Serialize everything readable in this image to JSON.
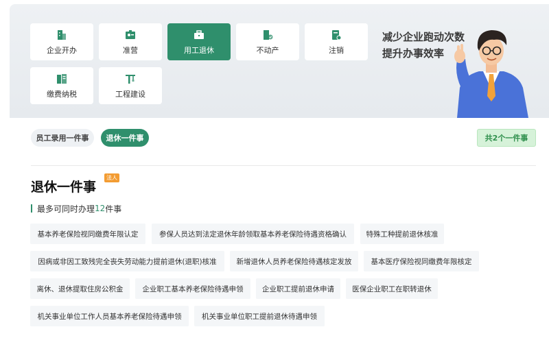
{
  "categories": [
    {
      "label": "企业开办",
      "icon": "building-icon",
      "active": false
    },
    {
      "label": "准营",
      "icon": "license-card-icon",
      "active": false
    },
    {
      "label": "用工退休",
      "icon": "briefcase-icon",
      "active": true
    },
    {
      "label": "不动产",
      "icon": "property-check-icon",
      "active": false
    },
    {
      "label": "注销",
      "icon": "document-cancel-icon",
      "active": false
    },
    {
      "label": "缴费纳税",
      "icon": "tax-fee-icon",
      "active": false
    },
    {
      "label": "工程建设",
      "icon": "crane-icon",
      "active": false
    }
  ],
  "slogan": {
    "line1": "减少企业跑动次数",
    "line2": "提升办事效率"
  },
  "tabs": [
    {
      "label": "员工录用一件事",
      "active": false
    },
    {
      "label": "退休一件事",
      "active": true
    }
  ],
  "count_badge": "共2个一件事",
  "section": {
    "title": "退休一件事",
    "badge": "法人",
    "sub_prefix": "最多可同时办理",
    "sub_number": "12",
    "sub_suffix": "件事"
  },
  "items": [
    "基本养老保险视同缴费年限认定",
    "参保人员达到法定退休年龄领取基本养老保险待遇资格确认",
    "特殊工种提前退休核准",
    "因病或非因工致残完全丧失劳动能力提前退休(退职)核准",
    "新增退休人员养老保险待遇核定发放",
    "基本医疗保险视同缴费年限核定",
    "离休、退休提取住房公积金",
    "企业职工基本养老保险待遇申领",
    "企业职工提前退休申请",
    "医保企业职工在职转退休",
    "机关事业单位工作人员基本养老保险待遇申领",
    "机关事业单位职工提前退休待遇申领"
  ],
  "colors": {
    "accent": "#2f8f6c",
    "badge_orange": "#f39c32",
    "count_green": "#d6f2d9"
  }
}
